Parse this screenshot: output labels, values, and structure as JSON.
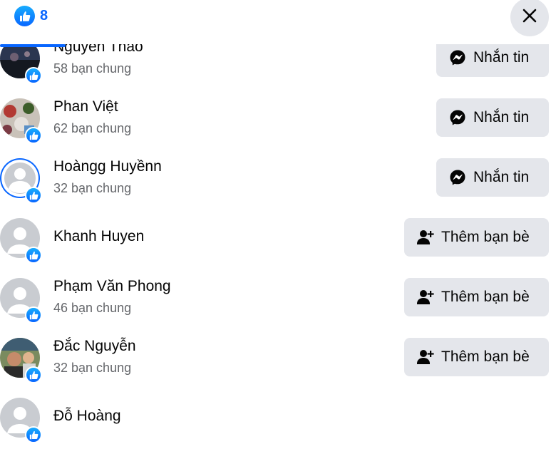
{
  "header": {
    "reaction_icon": "like-icon",
    "reaction_count": "8",
    "close_icon": "close-icon"
  },
  "people": [
    {
      "name": "Nguyễn Thảo",
      "mutual": "58 bạn chung",
      "action": "Nhắn tin",
      "action_icon": "messenger-icon"
    },
    {
      "name": "Phan Việt",
      "mutual": "62 bạn chung",
      "action": "Nhắn tin",
      "action_icon": "messenger-icon"
    },
    {
      "name": "Hoàngg Huyềnn",
      "mutual": "32 bạn chung",
      "action": "Nhắn tin",
      "action_icon": "messenger-icon"
    },
    {
      "name": "Khanh Huyen",
      "mutual": "",
      "action": "Thêm bạn bè",
      "action_icon": "add-friend-icon"
    },
    {
      "name": "Phạm Văn Phong",
      "mutual": "46 bạn chung",
      "action": "Thêm bạn bè",
      "action_icon": "add-friend-icon"
    },
    {
      "name": "Đắc Nguyễn",
      "mutual": "32 bạn chung",
      "action": "Thêm bạn bè",
      "action_icon": "add-friend-icon"
    },
    {
      "name": "Đỗ Hoàng",
      "mutual": "",
      "action": "",
      "action_icon": ""
    }
  ],
  "colors": {
    "accent": "#0866ff",
    "button_bg": "#e4e6eb",
    "secondary_text": "#65676b"
  }
}
